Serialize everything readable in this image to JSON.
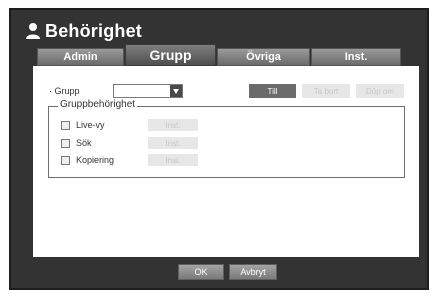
{
  "window": {
    "title": "Behörighet",
    "title_icon": "person-icon"
  },
  "tabs": [
    {
      "label": "Admin",
      "active": false
    },
    {
      "label": "Grupp",
      "active": true
    },
    {
      "label": "Övriga",
      "active": false
    },
    {
      "label": "Inst.",
      "active": false
    }
  ],
  "group_selector": {
    "label": "· Grupp",
    "selected_value": "",
    "buttons": {
      "add": "Till",
      "delete": "Ta bort",
      "rename": "Döp om"
    }
  },
  "permissions": {
    "legend": "Gruppbehörighet",
    "rows": [
      {
        "label": "Live-vy",
        "checked": false,
        "setup_label": "Inst."
      },
      {
        "label": "Sök",
        "checked": false,
        "setup_label": "Inst."
      },
      {
        "label": "Kopiering",
        "checked": false,
        "setup_label": "Inst."
      }
    ]
  },
  "footer": {
    "ok_label": "OK",
    "cancel_label": "Avbryt"
  },
  "colors": {
    "frame": "#333333",
    "panel": "#ffffff",
    "tab_active": "#4e4e4e",
    "button_dark": "#6b6b6b",
    "button_disabled": "#e7e7e7"
  }
}
